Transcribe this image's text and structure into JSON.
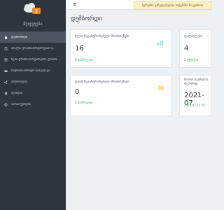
{
  "app": {
    "brand": "შეფუტება",
    "notice": "სერვისი განვლებულია სიტემაში 8აკუთხოი"
  },
  "topbar": {
    "menu_icon": "≡"
  },
  "sidebar": {
    "items": [
      {
        "label": "დეშბორდი",
        "icon": "home-icon",
        "active": true
      },
      {
        "label": "ახალი ტრანსპორტირების ს...",
        "icon": "file-icon",
        "active": false
      },
      {
        "label": "ჩემი ტრანსპორტირების ტრანს...",
        "icon": "list-icon",
        "active": false
      },
      {
        "label": "სატრანსპორტო საშუალეა",
        "icon": "truck-icon",
        "active": false
      },
      {
        "label": "მძღოლები",
        "icon": "share-icon",
        "active": false
      },
      {
        "label": "ძებნები",
        "icon": "gear-icon",
        "active": false
      },
      {
        "label": "პარამეტრები",
        "icon": "settings-icon",
        "active": false
      }
    ]
  },
  "main": {
    "title": "დეშბორდი",
    "cards": [
      {
        "title": "ხელი რეგისტრირებული მოთხოვნები",
        "value": "16",
        "sub": "8 დასრულდა",
        "icon": "chart-icon",
        "icon_color": "#4db7e6"
      },
      {
        "title": "ფილიალები",
        "value": "4",
        "sub": "2 აქტიური",
        "icon": "",
        "icon_color": ""
      },
      {
        "title": "დღეს რეგისტრირებული მოთხოვნები",
        "value": "0",
        "sub": "0 დასრულდა",
        "icon": "folder-icon",
        "icon_color": "#f2c94c"
      },
      {
        "title": "ბოლო საკრების რეპორტი",
        "value": "2021-07",
        "sub": "2021-07-11 50",
        "icon": "",
        "icon_color": ""
      }
    ]
  },
  "colors": {
    "sidebar": "#2f353f",
    "active": "#4e5560",
    "success": "#2bb05a",
    "notice": "#fbf0c8"
  }
}
